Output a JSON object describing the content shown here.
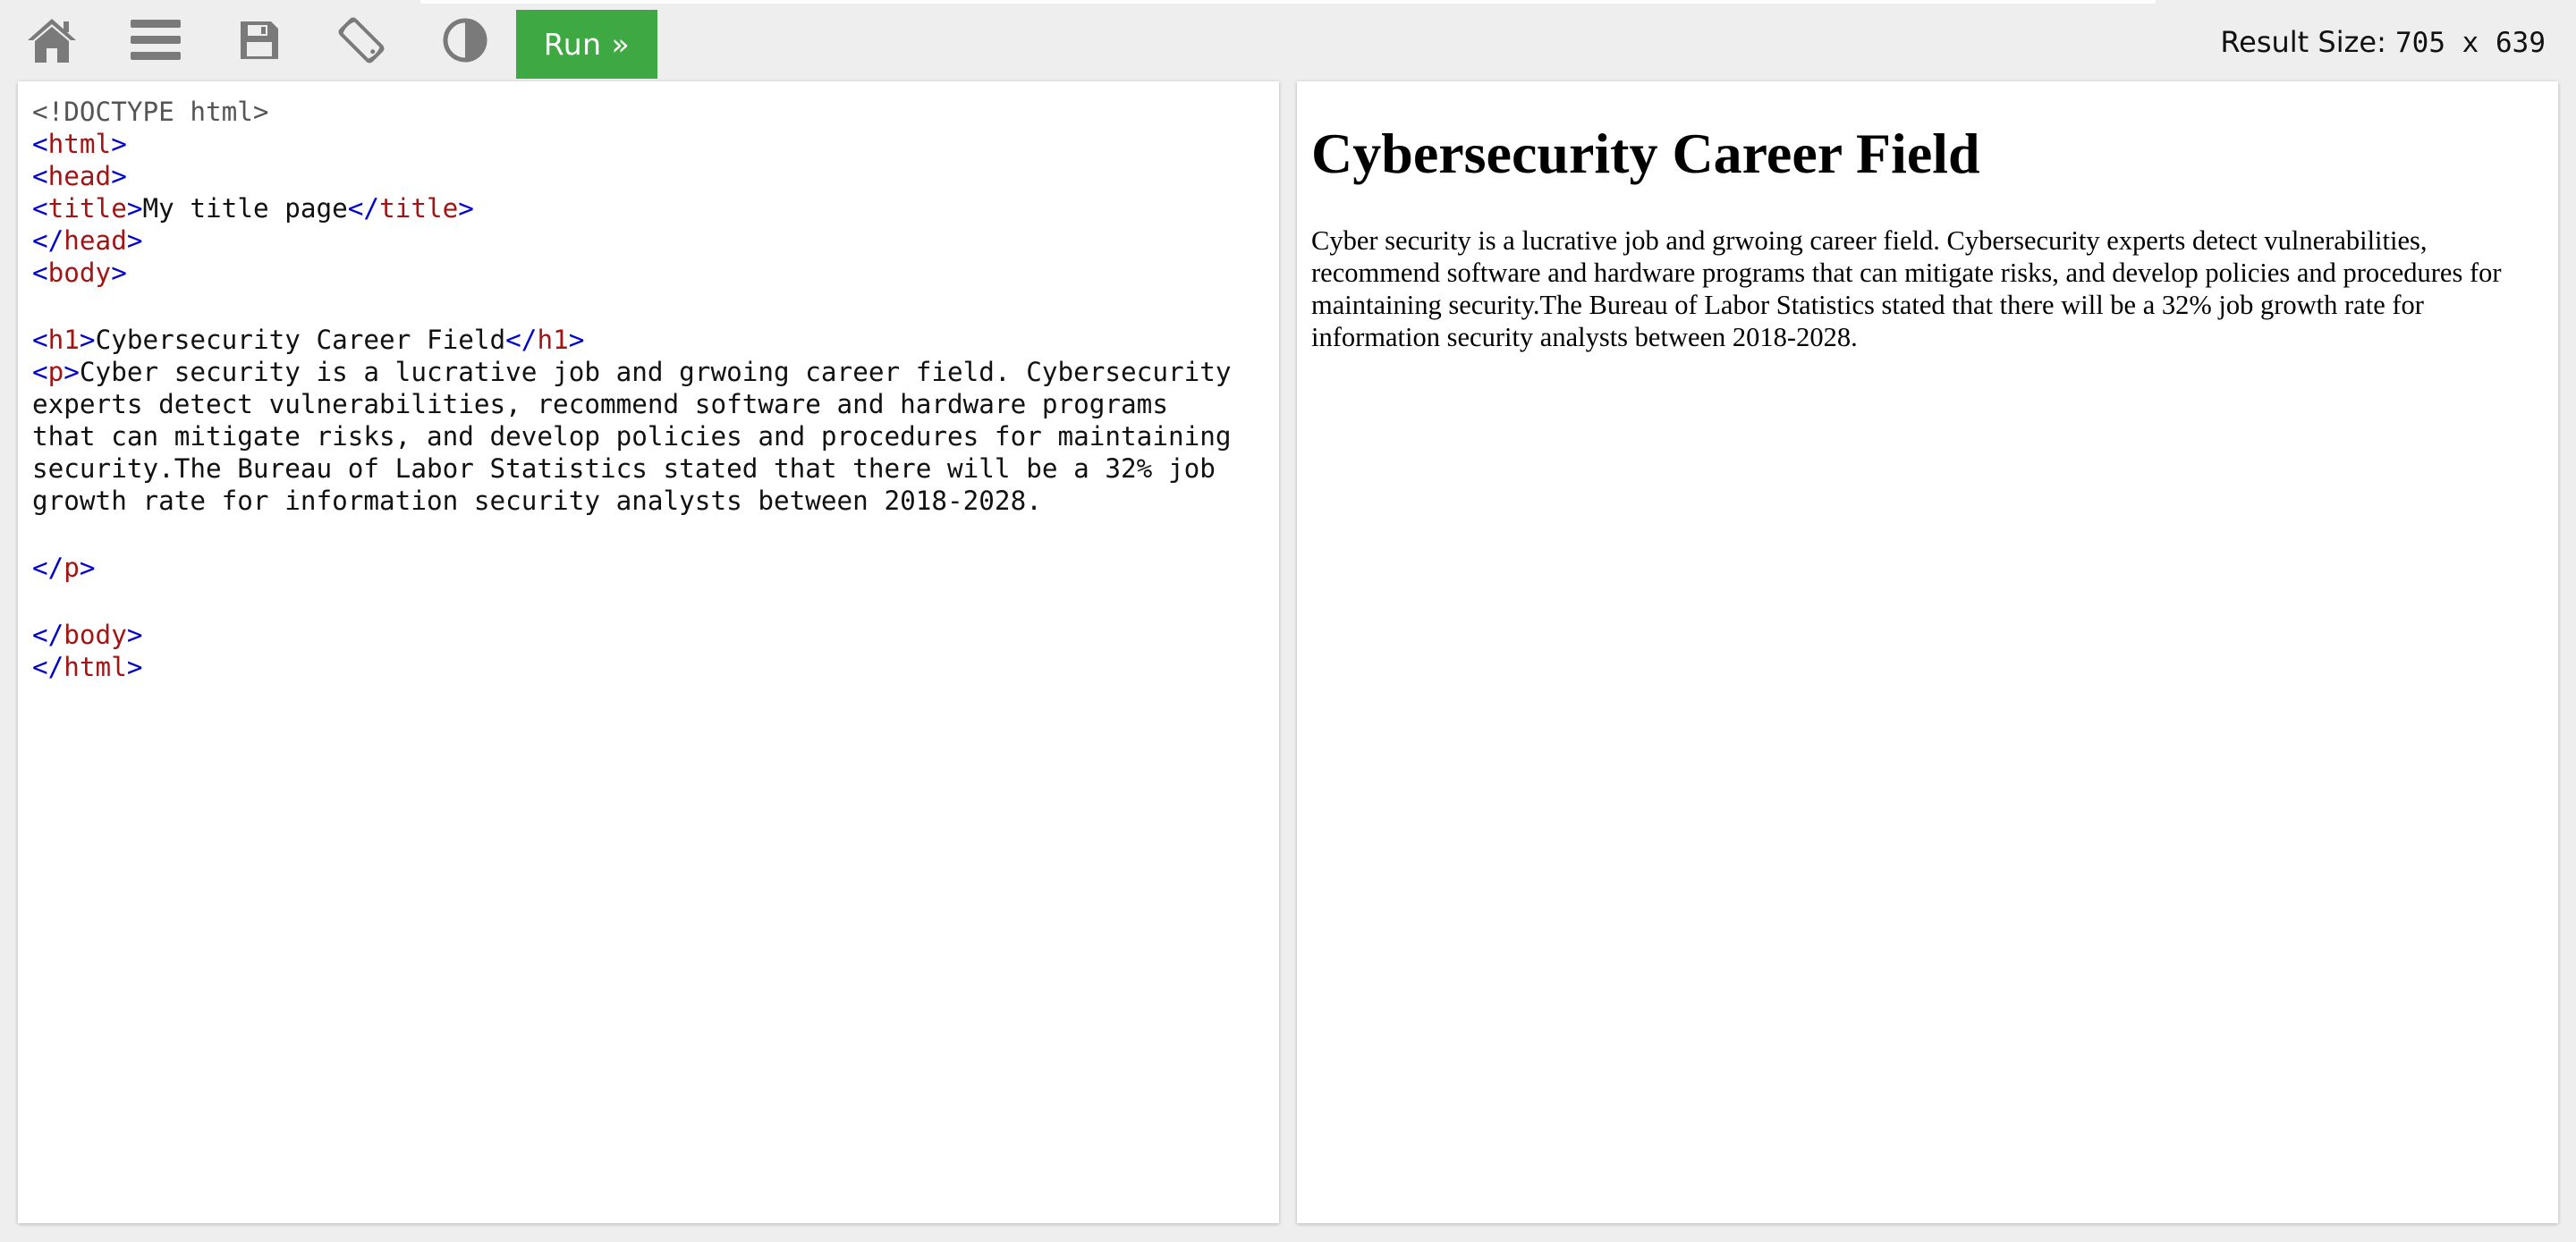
{
  "toolbar": {
    "icons": [
      {
        "name": "home-icon"
      },
      {
        "name": "menu-icon"
      },
      {
        "name": "save-icon"
      },
      {
        "name": "rotate-icon"
      },
      {
        "name": "contrast-icon"
      }
    ],
    "run_label": "Run »",
    "result_size_label": "Result Size:",
    "result_size_value": "705 x 639",
    "run_color": "#3ea843"
  },
  "editor": {
    "doctype": "<!DOCTYPE html>",
    "title_text": "My title page",
    "h1_text": "Cybersecurity Career Field",
    "p_lines": [
      "Cyber security is a lucrative job and grwoing career field. Cybersecurity",
      "experts detect vulnerabilities, recommend software and hardware programs",
      "that can mitigate risks, and develop policies and procedures for maintaining",
      "security.The Bureau of Labor Statistics stated that there will be a 32% job",
      "growth rate for information security analysts between 2018-2028."
    ],
    "tags": {
      "html_open": "html",
      "head_open": "head",
      "title_open": "title",
      "title_close": "title",
      "head_close": "head",
      "body_open": "body",
      "h1_open": "h1",
      "h1_close": "h1",
      "p_open": "p",
      "p_close": "p",
      "body_close": "body",
      "html_close": "html"
    }
  },
  "result": {
    "heading": "Cybersecurity Career Field",
    "paragraph": "Cyber security is a lucrative job and grwoing career field. Cybersecurity experts detect vulnerabilities, recommend software and hardware programs that can mitigate risks, and develop policies and procedures for maintaining security.The Bureau of Labor Statistics stated that there will be a 32% job growth rate for information security analysts between 2018-2028."
  },
  "colors": {
    "tag_name": "#a31515",
    "angle_bracket": "#0000cd",
    "toolbar_bg": "#eeeeee",
    "icon_gray": "#7a7a7a"
  }
}
